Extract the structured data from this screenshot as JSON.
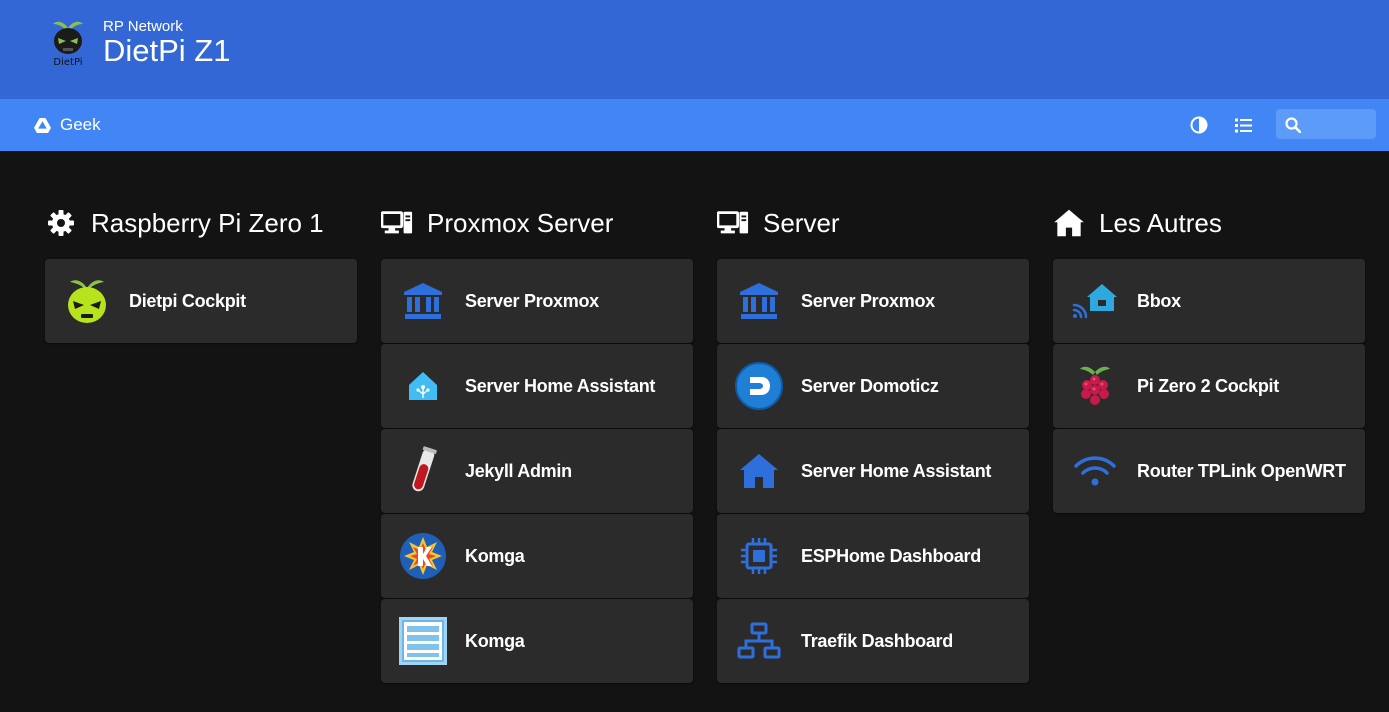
{
  "header": {
    "subtitle": "RP Network",
    "title": "DietPi Z1",
    "logo_text": "DietPi"
  },
  "navbar": {
    "link_label": "Geek",
    "link_icon": "drive-icon",
    "search_placeholder": ""
  },
  "colors": {
    "header_bg": "#3367d6",
    "navbar_bg": "#4285f4",
    "page_bg": "#131313",
    "card_bg": "#2b2b2b",
    "icon_blue": "#2f6fdb"
  },
  "columns": [
    {
      "title": "Raspberry Pi Zero 1",
      "icon": "gear-icon",
      "items": [
        {
          "name": "Dietpi Cockpit",
          "icon": "dietpi-logo-icon"
        }
      ]
    },
    {
      "title": "Proxmox Server",
      "icon": "desktop-server-icon",
      "items": [
        {
          "name": "Server Proxmox",
          "icon": "bank-icon"
        },
        {
          "name": "Server Home Assistant",
          "icon": "home-assistant-icon"
        },
        {
          "name": "Jekyll Admin",
          "icon": "test-tube-icon"
        },
        {
          "name": "Komga",
          "icon": "komga-k-icon"
        },
        {
          "name": "Komga",
          "icon": "list-panel-icon"
        }
      ]
    },
    {
      "title": "Server",
      "icon": "desktop-server-icon",
      "items": [
        {
          "name": "Server Proxmox",
          "icon": "bank-icon"
        },
        {
          "name": "Server Domoticz",
          "icon": "domoticz-icon"
        },
        {
          "name": "Server Home Assistant",
          "icon": "house-icon"
        },
        {
          "name": "ESPHome Dashboard",
          "icon": "microchip-icon"
        },
        {
          "name": "Traefik Dashboard",
          "icon": "network-icon"
        }
      ]
    },
    {
      "title": "Les Autres",
      "icon": "house-icon",
      "items": [
        {
          "name": "Bbox",
          "icon": "house-signal-icon"
        },
        {
          "name": "Pi Zero 2 Cockpit",
          "icon": "raspberry-pi-icon"
        },
        {
          "name": "Router TPLink OpenWRT",
          "icon": "wifi-icon"
        }
      ]
    }
  ]
}
